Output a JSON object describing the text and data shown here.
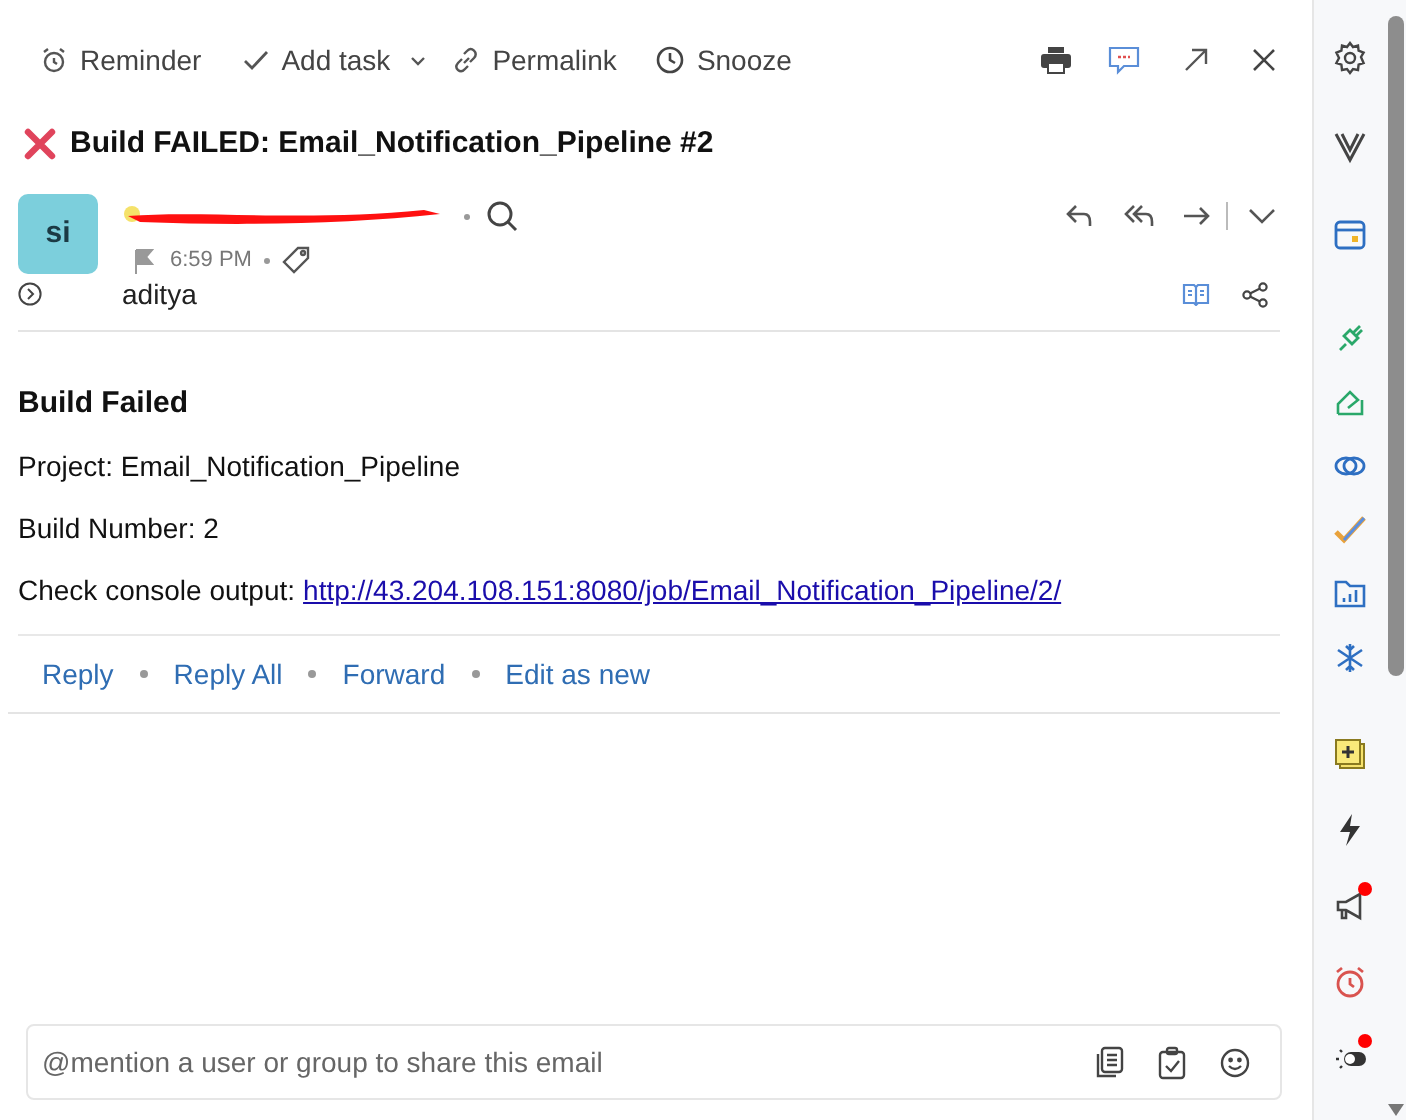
{
  "toolbar": {
    "actions": [
      {
        "kind": "reminder",
        "label": "Reminder"
      },
      {
        "kind": "task",
        "label": "Add task",
        "menu": true
      },
      {
        "kind": "link",
        "label": "Permalink"
      },
      {
        "kind": "snooze",
        "label": "Snooze"
      }
    ]
  },
  "subject": "Build FAILED: Email_Notification_Pipeline #2",
  "sender": {
    "initials": "si",
    "time": "6:59 PM",
    "recipient": "aditya"
  },
  "body": {
    "heading": "Build Failed",
    "lines": [
      {
        "kind": "text",
        "text": "Project: Email_Notification_Pipeline"
      },
      {
        "kind": "text",
        "text": "Build Number: 2"
      },
      {
        "kind": "link",
        "text": "Check console output:",
        "url": "http://43.204.108.151:8080/job/Email_Notification_Pipeline/2/"
      }
    ]
  },
  "reply_actions": [
    "Reply",
    "Reply All",
    "Forward",
    "Edit as new"
  ],
  "comment": {
    "placeholder": "@mention a user or group to share this email"
  },
  "sidebar": {
    "items": [
      {
        "kind": "gear",
        "notification": false
      },
      {
        "kind": "v",
        "notification": false
      },
      {
        "kind": "calendar",
        "notification": false
      },
      {
        "kind": "plug",
        "notification": false
      },
      {
        "kind": "sign",
        "notification": false
      },
      {
        "kind": "rings",
        "notification": false
      },
      {
        "kind": "check",
        "notification": false
      },
      {
        "kind": "folder",
        "notification": false
      },
      {
        "kind": "snow",
        "notification": false
      },
      {
        "kind": "note",
        "notification": false
      },
      {
        "kind": "bolt",
        "notification": false
      },
      {
        "kind": "megaphone",
        "notification": true
      },
      {
        "kind": "alarm",
        "notification": false
      },
      {
        "kind": "toggle",
        "notification": true
      }
    ]
  }
}
